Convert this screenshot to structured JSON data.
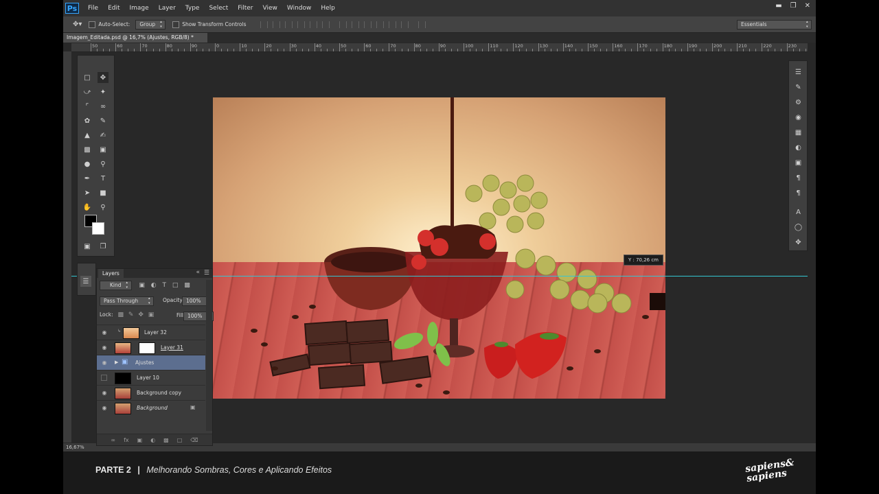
{
  "menubar": {
    "logo": "Ps",
    "items": [
      "File",
      "Edit",
      "Image",
      "Layer",
      "Type",
      "Select",
      "Filter",
      "View",
      "Window",
      "Help"
    ],
    "window_controls": [
      "minimize",
      "restore",
      "close"
    ]
  },
  "options": {
    "auto_select_label": "Auto-Select:",
    "auto_select_value": "Group",
    "transform_label": "Show Transform Controls",
    "workspace": "Essentials"
  },
  "document": {
    "tab_title": "Imagem_Editada.psd @ 16,7% (Ajustes, RGB/8) *",
    "ruler_labels": [
      "50",
      "60",
      "70",
      "80",
      "90",
      "0",
      "10",
      "20",
      "30",
      "40",
      "50",
      "60",
      "70",
      "80",
      "90",
      "100",
      "110",
      "120",
      "130",
      "140",
      "150",
      "160",
      "170",
      "180",
      "190",
      "200",
      "210",
      "220",
      "230"
    ],
    "guide_tooltip": "Y : 70,26 cm",
    "zoom": "16,67%"
  },
  "layers_panel": {
    "title": "Layers",
    "filter_kind": "Kind",
    "blend_mode": "Pass Through",
    "opacity_label": "Opacity:",
    "opacity_value": "100%",
    "lock_label": "Lock:",
    "fill_label": "Fill:",
    "fill_value": "100%",
    "layers": [
      {
        "name": "Layer 32",
        "visible": true,
        "selected": false
      },
      {
        "name": "Layer 31",
        "visible": true,
        "selected": false
      },
      {
        "name": "Ajustes",
        "visible": true,
        "selected": true
      },
      {
        "name": "Layer 10",
        "visible": false,
        "selected": false
      },
      {
        "name": "Background copy",
        "visible": true,
        "selected": false
      },
      {
        "name": "Background",
        "visible": true,
        "selected": false
      }
    ]
  },
  "footer": {
    "part": "PARTE 2",
    "separator": "|",
    "subtitle": "Melhorando Sombras, Cores e Aplicando Efeitos",
    "brand_line1": "sapiens&",
    "brand_line2": "sapiens"
  },
  "colors": {
    "accent_guide": "#33c7d4",
    "ps_blue": "#35a6ff",
    "selected_layer": "#5c6e8f"
  }
}
